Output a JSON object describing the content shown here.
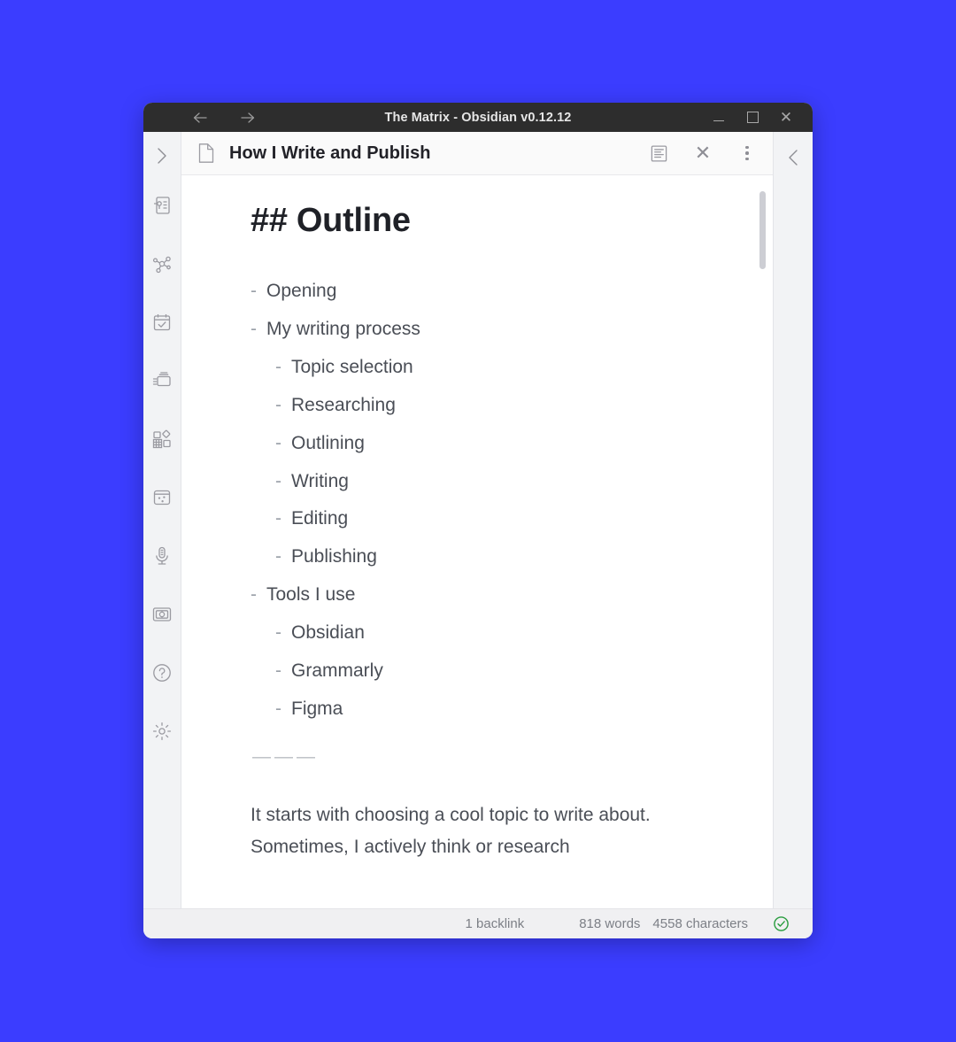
{
  "desktop": {
    "background_color": "#3b3dff"
  },
  "window": {
    "title": "The Matrix - Obsidian v0.12.12",
    "nav": {
      "back": "←",
      "forward": "→"
    },
    "controls": {
      "minimize": "minimize-button",
      "maximize": "maximize-button",
      "close": "✕"
    }
  },
  "tab": {
    "title": "How I Write and Publish",
    "file_icon": "file-icon",
    "actions": {
      "reading_view": "reading-view-icon",
      "close": "✕",
      "more": "more-options-icon"
    }
  },
  "ribbon": {
    "collapse": "›",
    "items": [
      {
        "icon": "file-explorer-icon"
      },
      {
        "icon": "graph-view-icon"
      },
      {
        "icon": "daily-note-icon"
      },
      {
        "icon": "quick-switcher-icon"
      },
      {
        "icon": "plugins-icon"
      },
      {
        "icon": "random-note-icon"
      },
      {
        "icon": "audio-recorder-icon"
      },
      {
        "icon": "slides-icon"
      },
      {
        "icon": "help-icon"
      },
      {
        "icon": "settings-icon"
      }
    ]
  },
  "right_rail": {
    "collapse": "‹"
  },
  "note": {
    "heading": "## Outline",
    "outline": [
      {
        "level": 1,
        "dash": "-",
        "text": "Opening"
      },
      {
        "level": 1,
        "dash": "-",
        "text": "My writing process"
      },
      {
        "level": 2,
        "dash": "-",
        "text": "Topic selection"
      },
      {
        "level": 2,
        "dash": "-",
        "text": "Researching"
      },
      {
        "level": 2,
        "dash": "-",
        "text": "Outlining"
      },
      {
        "level": 2,
        "dash": "-",
        "text": "Writing"
      },
      {
        "level": 2,
        "dash": "-",
        "text": "Editing"
      },
      {
        "level": 2,
        "dash": "-",
        "text": "Publishing"
      },
      {
        "level": 1,
        "dash": "-",
        "text": "Tools I use"
      },
      {
        "level": 2,
        "dash": "-",
        "text": "Obsidian"
      },
      {
        "level": 2,
        "dash": "-",
        "text": "Grammarly"
      },
      {
        "level": 2,
        "dash": "-",
        "text": "Figma"
      }
    ],
    "separator": "———",
    "paragraph": "It starts with choosing a cool topic to write about. Sometimes, I actively think or research"
  },
  "status": {
    "backlinks": "1 backlink",
    "words": "818 words",
    "characters": "4558 characters",
    "sync": "sync-ok-icon",
    "sync_color": "#2a9d3f"
  }
}
